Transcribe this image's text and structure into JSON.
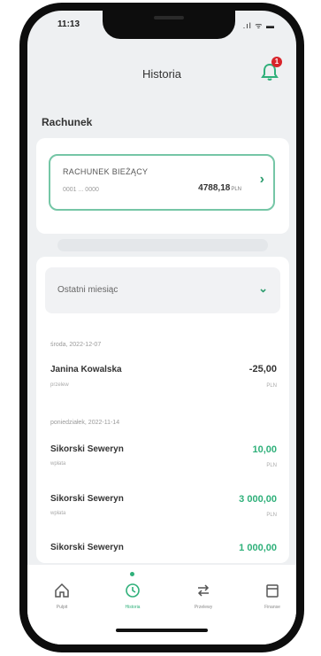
{
  "status": {
    "time": "11:13",
    "icons": ".ıl ᯤ ▬"
  },
  "header": {
    "title": "Historia",
    "notification_count": "1"
  },
  "account_section": {
    "label": "Rachunek",
    "card": {
      "name": "RACHUNEK BIEŻĄCY",
      "number": "0001 ... 0000",
      "balance": "4788,18",
      "currency": "PLN"
    }
  },
  "history": {
    "filter_label": "Ostatni miesiąc",
    "date_headers": [
      "środa, 2022-12-07",
      "poniedziałek, 2022-11-14"
    ],
    "transactions": [
      {
        "name": "Janina Kowalska",
        "type": "przelew",
        "amount": "-25,00",
        "currency": "PLN",
        "sign": "negative"
      },
      {
        "name": "Sikorski Seweryn",
        "type": "wpłata",
        "amount": "10,00",
        "currency": "PLN",
        "sign": "positive"
      },
      {
        "name": "Sikorski Seweryn",
        "type": "wpłata",
        "amount": "3 000,00",
        "currency": "PLN",
        "sign": "positive"
      },
      {
        "name": "Sikorski Seweryn",
        "type": "",
        "amount": "1 000,00",
        "currency": "",
        "sign": "positive"
      }
    ]
  },
  "tabbar": {
    "tabs": [
      {
        "label": "Pulpit",
        "icon": "home-icon"
      },
      {
        "label": "Historia",
        "icon": "history-icon",
        "active": true
      },
      {
        "label": "Przelewy",
        "icon": "transfer-icon"
      },
      {
        "label": "Finanse",
        "icon": "finance-icon"
      }
    ]
  },
  "colors": {
    "accent": "#2fb07a",
    "card_border": "#75c6a6",
    "badge": "#d8232a"
  }
}
